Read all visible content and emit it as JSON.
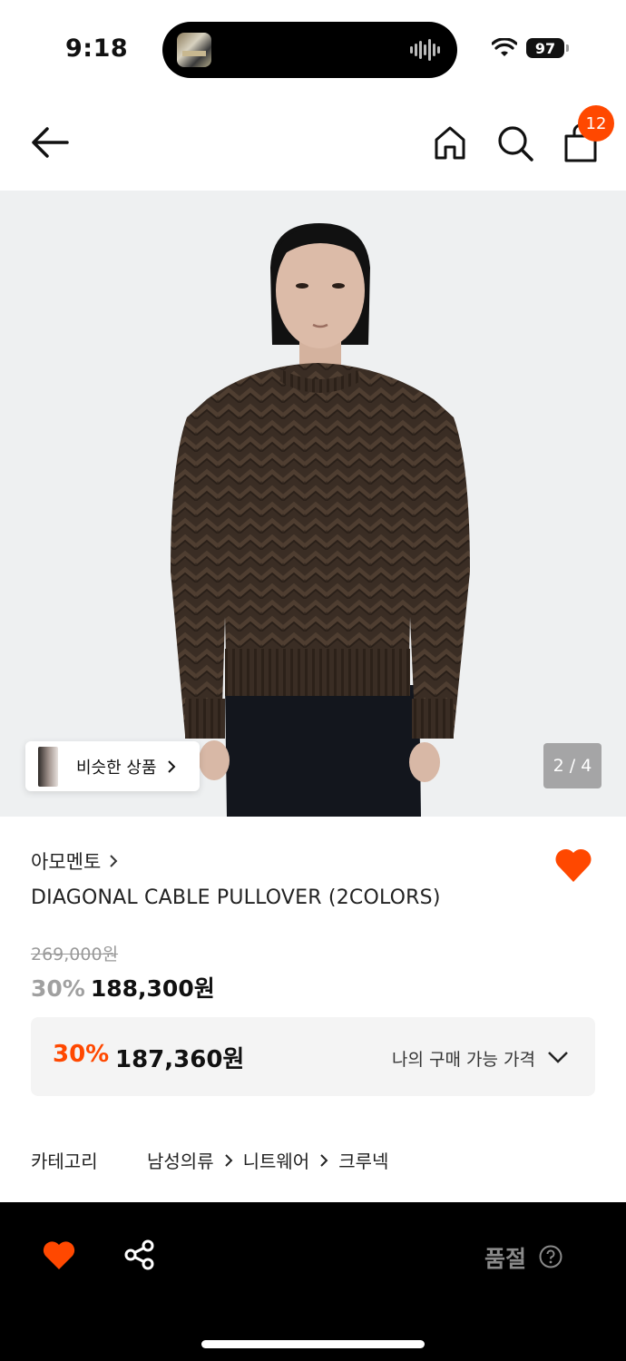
{
  "status_bar": {
    "time": "9:18",
    "battery": "97"
  },
  "header": {
    "cart_count": "12"
  },
  "gallery": {
    "similar_label": "비슷한 상품",
    "page_indicator": "2 / 4"
  },
  "product": {
    "brand": "아모멘토",
    "name": "DIAGONAL CABLE PULLOVER (2COLORS)",
    "original_price": "269,000원",
    "discount_percent": "30%",
    "sale_price": "188,300원",
    "liked": true
  },
  "my_price": {
    "discount_percent": "30%",
    "price": "187,360원",
    "label": "나의 구매 가능 가격"
  },
  "category": {
    "title": "카테고리",
    "path": [
      "남성의류",
      "니트웨어",
      "크루넥"
    ]
  },
  "bottom_bar": {
    "soldout_label": "품절"
  },
  "colors": {
    "accent": "#ff4800",
    "sweater": "#3d2f25",
    "background": "#eef0f1"
  }
}
